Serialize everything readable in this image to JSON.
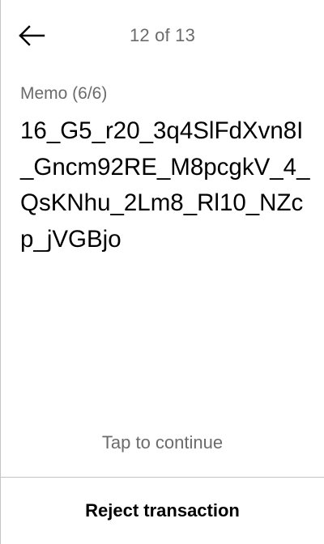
{
  "header": {
    "back_icon": "arrow-left-icon",
    "page_counter": "12 of 13"
  },
  "memo": {
    "label": "Memo (6/6)",
    "value": "16_G5_r20_3q4SlFdXvn8I_Gncm92RE_M8pcgkV_4_QsKNhu_2Lm8_Rl10_NZcp_jVGBjo"
  },
  "footer": {
    "tap_to_continue": "Tap to continue",
    "reject_label": "Reject transaction"
  },
  "colors": {
    "text_primary": "#000000",
    "text_secondary": "#6b6b6b",
    "divider": "#c4c4c4",
    "background": "#ffffff"
  }
}
